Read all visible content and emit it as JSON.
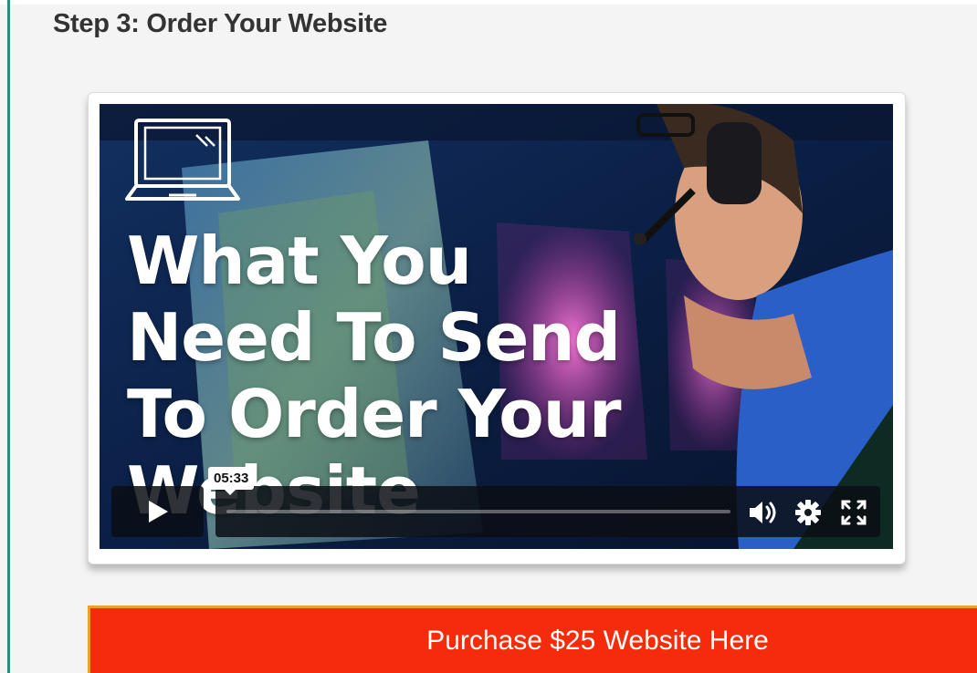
{
  "step": {
    "heading": "Step 3: Order Your Website"
  },
  "video": {
    "title_lines": [
      "What You",
      "Need To Send",
      "To Order Your",
      "Website"
    ],
    "thumbnail_icon": "laptop-icon",
    "controls": {
      "play_icon": "play-icon",
      "time_tooltip": "05:33",
      "volume_icon": "volume-icon",
      "settings_icon": "gear-icon",
      "fullscreen_icon": "fullscreen-icon"
    }
  },
  "purchase": {
    "label": "Purchase $25 Website Here"
  },
  "colors": {
    "accent_rule": "#2e8b7a",
    "purchase_bg": "#f42c0c",
    "purchase_border": "#f0a020"
  }
}
